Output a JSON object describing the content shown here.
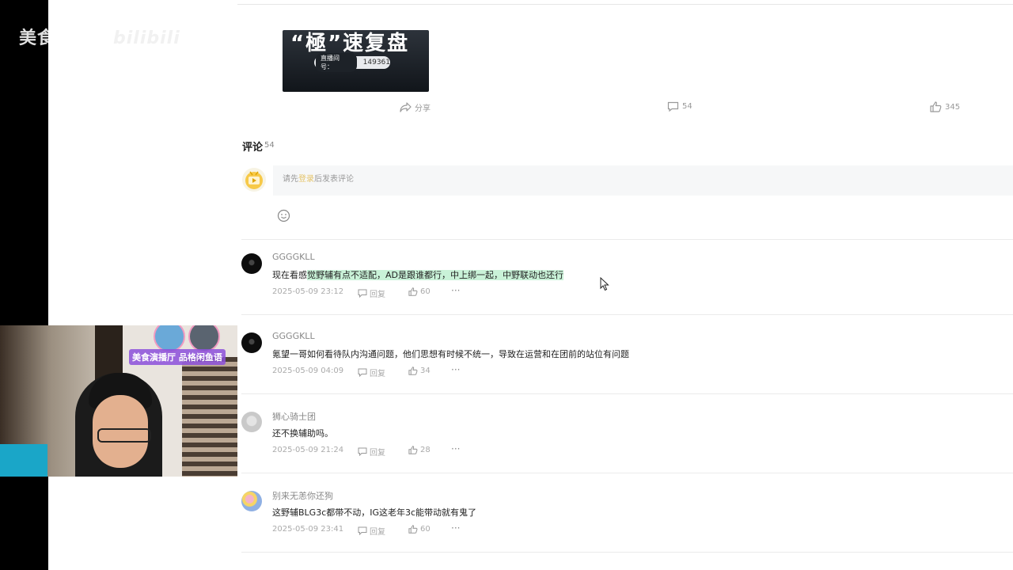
{
  "watermark": {
    "text": "美食区香锅",
    "brand": "bilibili"
  },
  "post_image": {
    "title": "“極”速复盘",
    "room_label": "直播间号：",
    "room_number": "149361"
  },
  "actions": {
    "share": "分享",
    "comments": "54",
    "likes": "345"
  },
  "comments_section": {
    "title": "评论",
    "count": "54",
    "compose": {
      "prefix": "请先",
      "login": "登录",
      "suffix": "后发表评论"
    }
  },
  "comments": [
    {
      "user": "GGGGKLL",
      "text_plain": "现在看感",
      "text_highlight": "觉野辅有点不适配，AD是跟谁都行，中上绑一起，中野联动也还行",
      "time": "2025-05-09 23:12",
      "reply": "回复",
      "likes": "60",
      "more": "···"
    },
    {
      "user": "GGGGKLL",
      "text": "氪望一哥如何看待队内沟通问题，他们思想有时候不统一，导致在运营和在团前的站位有问题",
      "time": "2025-05-09 04:09",
      "reply": "回复",
      "likes": "34",
      "more": "···"
    },
    {
      "user": "狮心骑士团",
      "text": "还不换辅助吗。",
      "time": "2025-05-09 21:24",
      "reply": "回复",
      "likes": "28",
      "more": "···"
    },
    {
      "user": "别来无恙你还狗",
      "text": "这野辅BLG3c都带不动，IG这老年3c能带动就有鬼了",
      "time": "2025-05-09 23:41",
      "reply": "回复",
      "likes": "60",
      "more": "···"
    }
  ],
  "webcam": {
    "banner": "美食演播厅 品格闲鱼语"
  }
}
